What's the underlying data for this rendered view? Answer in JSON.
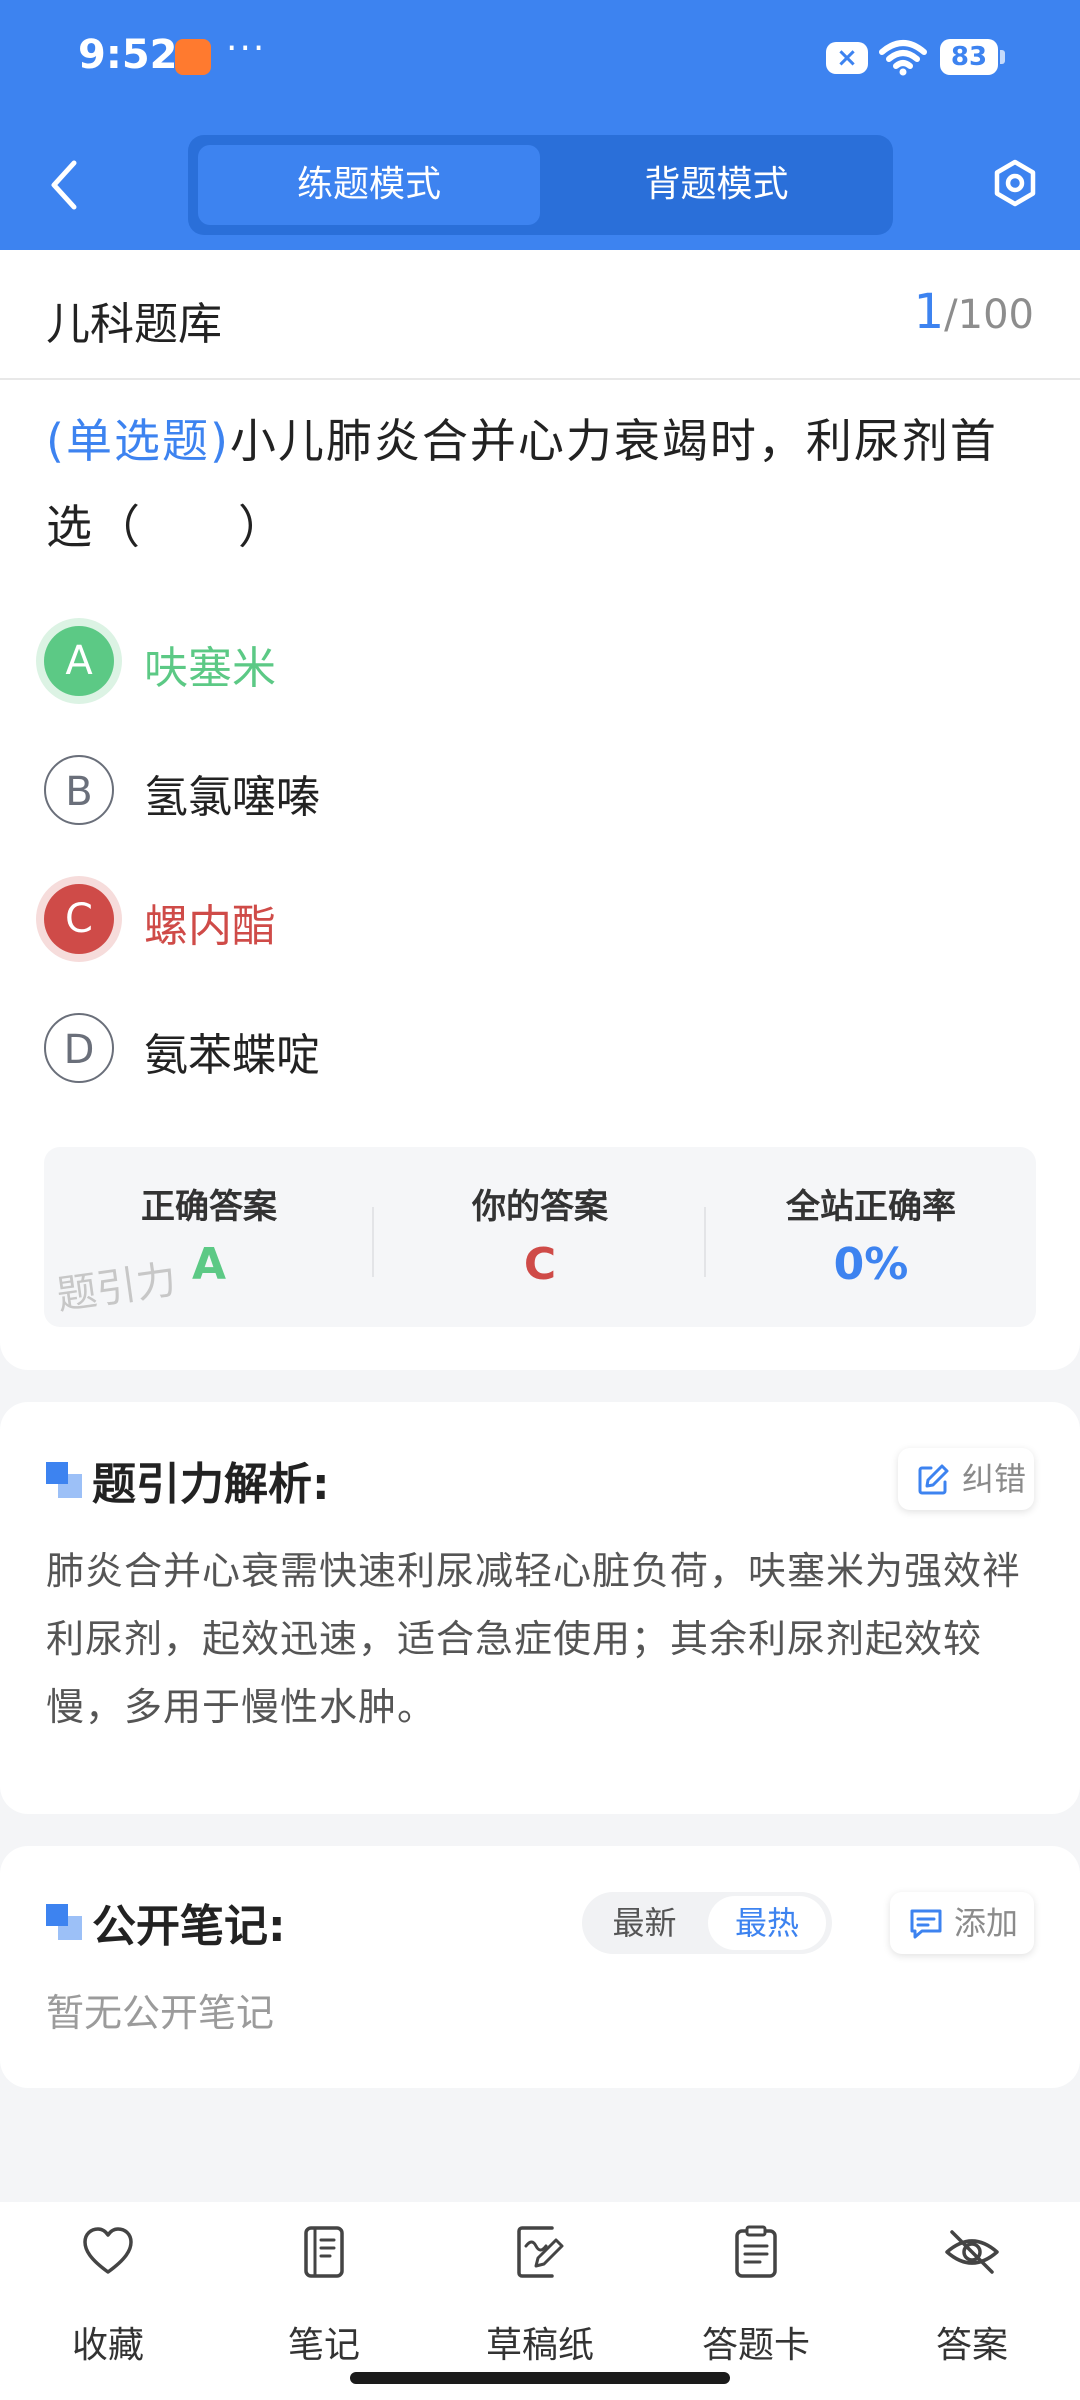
{
  "status_bar": {
    "time": "9:52",
    "more": "···",
    "battery": "83",
    "x_icon": "×"
  },
  "header": {
    "modes": [
      "练题模式",
      "背题模式"
    ],
    "active_mode": 0
  },
  "question_card": {
    "bank_title": "儿科题库",
    "progress_current": "1",
    "progress_total": "/100",
    "question_type": "(单选题)",
    "question_text": "小儿肺炎合并心力衰竭时，利尿剂首选（　　）",
    "options": [
      {
        "letter": "A",
        "text": "呋塞米",
        "state": "correct"
      },
      {
        "letter": "B",
        "text": "氢氯噻嗪",
        "state": "normal"
      },
      {
        "letter": "C",
        "text": "螺内酯",
        "state": "wrong"
      },
      {
        "letter": "D",
        "text": "氨苯蝶啶",
        "state": "normal"
      }
    ],
    "answer_summary": {
      "correct_label": "正确答案",
      "correct_value": "A",
      "yours_label": "你的答案",
      "yours_value": "C",
      "rate_label": "全站正确率",
      "rate_value": "0%"
    },
    "watermark": "题引力"
  },
  "analysis": {
    "title": "题引力解析:",
    "report_button": "纠错",
    "text": "肺炎合并心衰需快速利尿减轻心脏负荷，呋塞米为强效袢利尿剂，起效迅速，适合急症使用；其余利尿剂起效较慢，多用于慢性水肿。"
  },
  "notes": {
    "title": "公开笔记:",
    "sort_options": [
      "最新",
      "最热"
    ],
    "active_sort": 1,
    "add_button": "添加",
    "empty_text": "暂无公开笔记"
  },
  "bottom_bar": {
    "tabs": [
      {
        "label": "收藏",
        "icon": "heart-icon"
      },
      {
        "label": "笔记",
        "icon": "notebook-icon"
      },
      {
        "label": "草稿纸",
        "icon": "draft-icon"
      },
      {
        "label": "答题卡",
        "icon": "answer-sheet-icon"
      },
      {
        "label": "答案",
        "icon": "eye-off-icon"
      }
    ]
  },
  "colors": {
    "brand": "#3d83f0",
    "correct": "#5cc985",
    "wrong": "#cf4b48"
  }
}
